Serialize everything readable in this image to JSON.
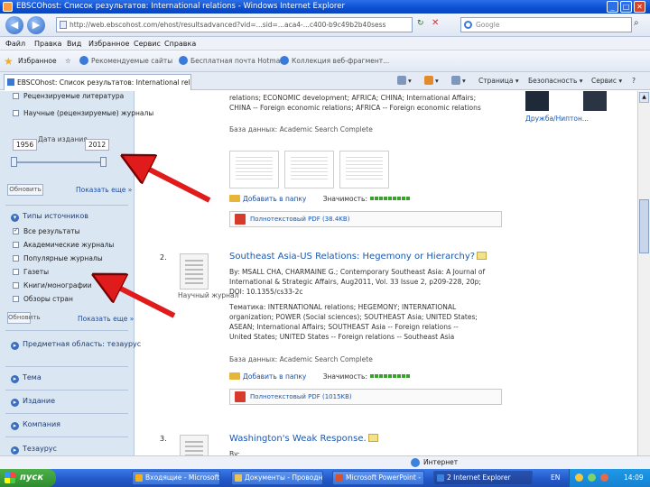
{
  "window": {
    "title": "EBSCOhost: Список результатов: International relations - Windows Internet Explorer",
    "controls": [
      "_",
      "□",
      "✕"
    ]
  },
  "address": {
    "url": "http://web.ebscohost.com/ehost/resultsadvanced?vid=...sid=...aca4-...c400-b9c49b2b40sess",
    "search_engine": "Google",
    "search_placeholder": "Google"
  },
  "menu": [
    "Файл",
    "Правка",
    "Вид",
    "Избранное",
    "Сервис",
    "Справка"
  ],
  "favorites": {
    "label": "Избранное",
    "items": [
      "Рекомендуемые сайты",
      "Бесплатная почта Hotmail",
      "Коллекция веб-фрагмент..."
    ]
  },
  "tab": {
    "title": "EBSCOhost: Список результатов: International rela...",
    "commands": [
      "Страница",
      "Безопасность",
      "Сервис"
    ]
  },
  "sidebar": {
    "top_items": [
      "Рецензируемые литература",
      "Научные (рецензируемые) журналы"
    ],
    "date_label": "Дата издания",
    "date_from": "1956",
    "date_to": "2012",
    "update_button": "Обновить",
    "show_more": "Показать еще »",
    "source_types_title": "Типы источников",
    "source_types": [
      {
        "label": "Все результаты",
        "checked": true
      },
      {
        "label": "Академические журналы",
        "checked": false
      },
      {
        "label": "Популярные журналы",
        "checked": false
      },
      {
        "label": "Газеты",
        "checked": false
      },
      {
        "label": "Книги/монографии",
        "checked": false
      },
      {
        "label": "Обзоры стран",
        "checked": false
      }
    ],
    "update_button_2": "Обновить",
    "show_more_2": "Показать еще »",
    "sections": [
      "Предметная область: тезаурус",
      "Тема",
      "Издание",
      "Компания",
      "Тезаурус"
    ]
  },
  "results": [
    {
      "snippet_lines": [
        "relations; ECONOMIC development; AFRICA; CHINA; International Affairs;",
        "CHINA -- Foreign economic relations; AFRICA -- Foreign economic relations"
      ],
      "database": "База данных: Academic Search Complete",
      "add_to_folder": "Добавить в папку",
      "relevance": "Значимость:",
      "fulltext": "Полнотекстовый PDF (38.4KB)"
    },
    {
      "number": "2.",
      "title": "Southeast Asia-US Relations: Hegemony or Hierarchy?",
      "doctype": "Научный журнал",
      "snippet_lines": [
        "By: MSALL CHA, CHARMAINE G.; Contemporary Southeast Asia: A Journal of",
        "International & Strategic Affairs, Aug2011, Vol. 33 Issue 2, p209-228, 20p;",
        "DOI: 10.1355/cs33-2c",
        "Тематика: INTERNATIONAL relations; HEGEMONY; INTERNATIONAL",
        "organization; POWER (Social sciences); SOUTHEAST Asia; UNITED States;",
        "ASEAN; International Affairs; SOUTHEAST Asia -- Foreign relations --",
        "United States; UNITED States -- Foreign relations -- Southeast Asia"
      ],
      "database": "База данных: Academic Search Complete",
      "add_to_folder": "Добавить в папку",
      "relevance": "Значимость:",
      "fulltext": "Полнотекстовый PDF (1015KB)"
    },
    {
      "number": "3.",
      "title": "Washington's Weak Response.",
      "snippet_lines": [
        "By: ..."
      ]
    }
  ],
  "right_panel": {
    "thumb_caption": "Дружба/Ниптон..."
  },
  "taskbar": {
    "start": "пуск",
    "buttons": [
      {
        "label": "Входящие - Microsoft ...",
        "color": "#f2b01e"
      },
      {
        "label": "Документы - Проводник ...",
        "color": "#e8c35a"
      },
      {
        "label": "Microsoft PowerPoint - ...",
        "color": "#d9502c"
      },
      {
        "label": "2 Internet Explorer",
        "color": "#3b82e0"
      }
    ],
    "lang": "EN",
    "time": "14:09"
  },
  "status": {
    "zone": "Интернет"
  }
}
